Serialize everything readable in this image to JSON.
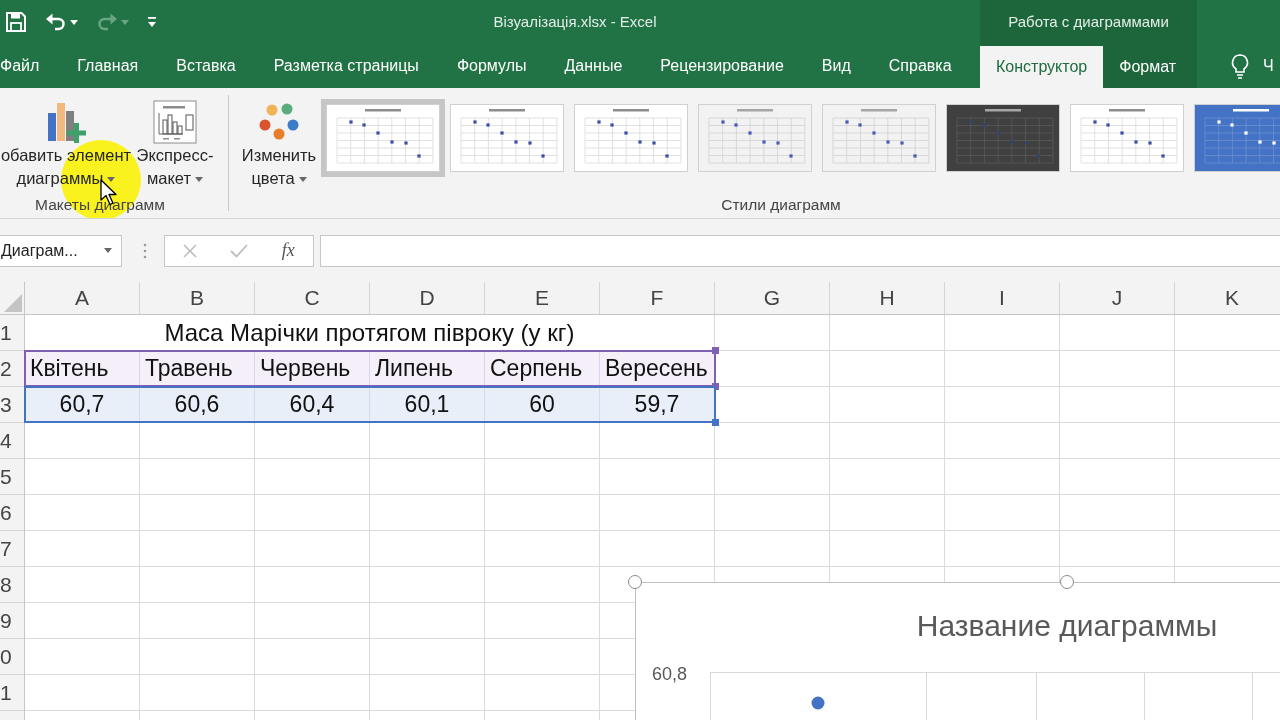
{
  "window": {
    "title": "Візуалізація.xlsx - Excel"
  },
  "quick_access": [
    {
      "kind": "save",
      "disabled": false
    },
    {
      "kind": "undo",
      "disabled": false
    },
    {
      "kind": "redo",
      "disabled": true
    },
    {
      "kind": "customize",
      "disabled": false
    }
  ],
  "contextual_group": {
    "label": "Работа с диаграммами"
  },
  "ribbon_tabs": [
    {
      "label": "Файл",
      "selected": false,
      "contextual": false
    },
    {
      "label": "Главная",
      "selected": false,
      "contextual": false
    },
    {
      "label": "Вставка",
      "selected": false,
      "contextual": false
    },
    {
      "label": "Разметка страницы",
      "selected": false,
      "contextual": false
    },
    {
      "label": "Формулы",
      "selected": false,
      "contextual": false
    },
    {
      "label": "Данные",
      "selected": false,
      "contextual": false
    },
    {
      "label": "Рецензирование",
      "selected": false,
      "contextual": false
    },
    {
      "label": "Вид",
      "selected": false,
      "contextual": false
    },
    {
      "label": "Справка",
      "selected": false,
      "contextual": false
    },
    {
      "label": "Конструктор",
      "selected": true,
      "contextual": true
    },
    {
      "label": "Формат",
      "selected": false,
      "contextual": true
    }
  ],
  "tell_me": {
    "label": "Ч"
  },
  "ribbon_groups": [
    {
      "label": "Макеты диаграмм",
      "buttons": [
        {
          "kind": "add_element",
          "label": "обавить элемент диаграммы",
          "dropdown": true
        },
        {
          "kind": "quick_layout",
          "label": "Экспресс-макет",
          "dropdown": true
        }
      ]
    },
    {
      "label": "Стили диаграмм",
      "buttons": [
        {
          "kind": "change_colors",
          "label": "Изменить цвета",
          "dropdown": true
        }
      ],
      "styles": [
        {
          "kind": "plain",
          "selected": true
        },
        {
          "kind": "plain",
          "selected": false
        },
        {
          "kind": "plain",
          "selected": false
        },
        {
          "kind": "shaded",
          "selected": false
        },
        {
          "kind": "shaded",
          "selected": false
        },
        {
          "kind": "dark",
          "selected": false
        },
        {
          "kind": "plain",
          "selected": false
        },
        {
          "kind": "blue",
          "selected": false
        }
      ]
    }
  ],
  "name_box": {
    "value": "Диаграм..."
  },
  "formula_bar": {
    "buttons": [
      {
        "kind": "cancel",
        "disabled": true
      },
      {
        "kind": "enter",
        "disabled": true
      },
      {
        "kind": "function",
        "label": "fx",
        "disabled": false
      }
    ]
  },
  "sheet": {
    "columns": [
      "A",
      "B",
      "C",
      "D",
      "E",
      "F",
      "G",
      "H",
      "I",
      "J",
      "K"
    ],
    "rows": [
      {
        "header": "1",
        "kind": "title",
        "cells": [
          "Маса Марічки протягом півроку (у кг)"
        ]
      },
      {
        "header": "2",
        "kind": "labels",
        "cells": [
          "Квітень",
          "Травень",
          "Червень",
          "Липень",
          "Серпень",
          "Вересень"
        ]
      },
      {
        "header": "3",
        "kind": "values",
        "cells": [
          "60,7",
          "60,6",
          "60,4",
          "60,1",
          "60",
          "59,7"
        ]
      },
      {
        "header": "4",
        "kind": "empty"
      },
      {
        "header": "5",
        "kind": "empty"
      },
      {
        "header": "6",
        "kind": "empty"
      },
      {
        "header": "7",
        "kind": "empty"
      },
      {
        "header": "8",
        "kind": "empty"
      },
      {
        "header": "9",
        "kind": "empty"
      },
      {
        "header": "0",
        "kind": "empty"
      },
      {
        "header": "1",
        "kind": "empty"
      }
    ]
  },
  "chart": {
    "title": "Название диаграммы",
    "y_axis_labels": [
      "60,8"
    ],
    "selected": true
  }
}
